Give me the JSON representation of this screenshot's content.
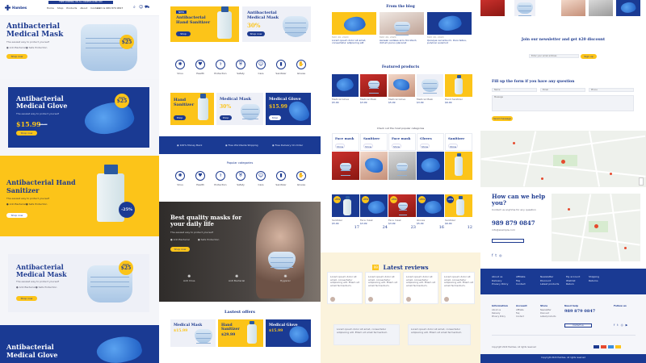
{
  "col1": {
    "brand": "Hambes",
    "topbar": "FREE SHIPPING ON ALL ORDERS OVER $50",
    "nav": [
      "Home",
      "Shop",
      "Products",
      "About",
      "Contact"
    ],
    "phone": "Call Us 989 879 0847",
    "hero1": {
      "title": "Antibacterial Medical Mask",
      "subtitle": "The easiest way to protect yourself",
      "feat1": "Anti Bacterial",
      "feat2": "Safe Protection",
      "button": "Shop now",
      "badge_top": "ONLY",
      "badge_price": "$25"
    },
    "hero2": {
      "title": "Antibacterial Medical Glove",
      "subtitle": "The easiest way to protect yourself",
      "price": "$15.99",
      "old_price": "$20.99",
      "button": "Shop now",
      "badge_top": "ONLY",
      "badge_price": "$25"
    },
    "hero3": {
      "title": "Antibacterial Hand Sanitizer",
      "subtitle": "The easiest way to protect yourself",
      "feat1": "Anti Bacterial",
      "feat2": "Safe Protection",
      "button": "Shop now",
      "badge": "-25%"
    },
    "hero4": {
      "title": "Antibacterial Medical Mask",
      "subtitle": "The easiest way to protect yourself",
      "feat1": "Anti Bacterial",
      "feat2": "Safe Protection",
      "button": "Shop now",
      "badge_top": "ONLY",
      "badge_price": "$25"
    },
    "hero5": {
      "title": "Antibacterial Medical Glove"
    }
  },
  "col2": {
    "promo1": {
      "tag": "NEW",
      "title": "Antibacterial Hand Sanitizer",
      "button": "Shop"
    },
    "promo2": {
      "title": "Antibacterial Medical Mask",
      "discount": "30%",
      "button": "Shop now"
    },
    "icons_row1": [
      "Virus",
      "Health",
      "Protection",
      "Safety",
      "Care",
      "Sanitizer",
      "Gloves"
    ],
    "promo3": {
      "title": "Hand Sanitizer",
      "button": "Shop"
    },
    "promo4": {
      "title": "Medical Mask",
      "discount": "30%",
      "button": "Shop"
    },
    "promo5": {
      "title": "Medical Glove",
      "price": "$15.99",
      "button": "Shop"
    },
    "shipping": [
      "100% Money Back",
      "Free Worldwide Shipping",
      "Free Delivery On Order"
    ],
    "categories_title": "Popular categories",
    "icons_row2": [
      "Virus",
      "Health",
      "Protection",
      "Safety",
      "Care",
      "Sanitizer",
      "Gloves"
    ],
    "banner": {
      "title": "Best quality masks for your daily life",
      "subtitle": "The easiest way to protect yourself",
      "feat1": "Anti Bacterial",
      "feat2": "Safe Protection",
      "button": "Shop now",
      "stat1": "Anti Virus",
      "stat2": "Anti Bacterial",
      "stat3": "Hygienic"
    },
    "offers_title": "Lastest offers",
    "offers": [
      {
        "title": "Medical Mask",
        "price": "$15.99"
      },
      {
        "title": "Hand Sanitizer",
        "price": "$29.99"
      },
      {
        "title": "Medical Glove",
        "price": "$15.99"
      }
    ]
  },
  "col3": {
    "blog_title": "From the blog",
    "blog_posts": [
      {
        "date": "MAY 20, 2020",
        "text": "Lorem ipsum dolor sit amet, consectetur adipiscing elit"
      },
      {
        "date": "MAY 20, 2020",
        "text": "Aenean sodales arcu tincidunt, dictum purus placerat"
      },
      {
        "date": "MAY 20, 2020",
        "text": "Quisque vel ante mi. Duis tellus, pulvinar euismod"
      }
    ],
    "featured_title": "Featured products",
    "featured": [
      {
        "name": "Medical Glove",
        "price": "$5.99"
      },
      {
        "name": "Medical Mask",
        "price": "$3.99"
      },
      {
        "name": "Medical Glove",
        "price": "$5.99"
      },
      {
        "name": "Medical Mask",
        "price": "$3.99"
      },
      {
        "name": "Hand Sanitizer",
        "price": "$6.99"
      }
    ],
    "popular_title": "Check out the most popular categories",
    "popular": [
      "Face mask",
      "Sanitizer",
      "Face mask",
      "Gloves",
      "Sanitizer"
    ],
    "popular_button": "Show",
    "deals": [
      {
        "badge": "-25%",
        "name": "Sanitizer",
        "price": "$5.99",
        "count": "17"
      },
      {
        "badge": "-25%",
        "name": "Face mask",
        "price": "$3.99",
        "count": "24"
      },
      {
        "badge": "-25%",
        "name": "Face mask",
        "price": "$3.99",
        "count": "23"
      },
      {
        "badge": "-25%",
        "name": "Gloves",
        "price": "$5.99",
        "count": "16"
      },
      {
        "badge": "-25%",
        "name": "Sanitizer",
        "price": "$6.99",
        "count": "12"
      }
    ],
    "reviews_title": "Latest reviews",
    "reviews_icon": "99",
    "reviews": [
      "Lorem ipsum dolor sit amet, consectetur adipiscing elit. Etiam sit amet fermentum.",
      "Lorem ipsum dolor sit amet, consectetur adipiscing elit. Etiam sit amet fermentum.",
      "Lorem ipsum dolor sit amet, consectetur adipiscing elit. Etiam sit amet fermentum.",
      "Lorem ipsum dolor sit amet, consectetur adipiscing elit. Etiam sit amet fermentum."
    ]
  },
  "col4": {
    "newsletter_title": "Join our newsletter and get $20 discount",
    "newsletter_placeholder": "Enter your email address",
    "newsletter_button": "Sign up",
    "form_title": "Fill up the form if you have any question",
    "form_fields": [
      "Name",
      "Email",
      "Phone"
    ],
    "form_message": "Message",
    "form_button": "Send message",
    "help_title": "How can we help you?",
    "help_sub": "Contact us anytime for any question",
    "help_phone": "989 879 0847",
    "help_email": "info@example.com",
    "footer_cols": [
      [
        "About us",
        "Delivery",
        "Privacy Policy"
      ],
      [
        "Affiliate",
        "Faq",
        "Contact"
      ],
      [
        "Newsletter",
        "Discount",
        "Latest products"
      ],
      [
        "My account",
        "Wishlist",
        "Return"
      ],
      [
        "Shipping",
        "Returns"
      ]
    ],
    "footer2_heads": [
      "Information",
      "Account",
      "Store",
      "Need help"
    ],
    "footer2_phone": "989 879 0847",
    "footer2_follow": "Follow us",
    "footer2_button": "Contact us",
    "copyright1": "Copyright 2020 Hambes. All rights reserved",
    "copyright2": "Copyright 2020 Hambes. All rights reserved"
  }
}
